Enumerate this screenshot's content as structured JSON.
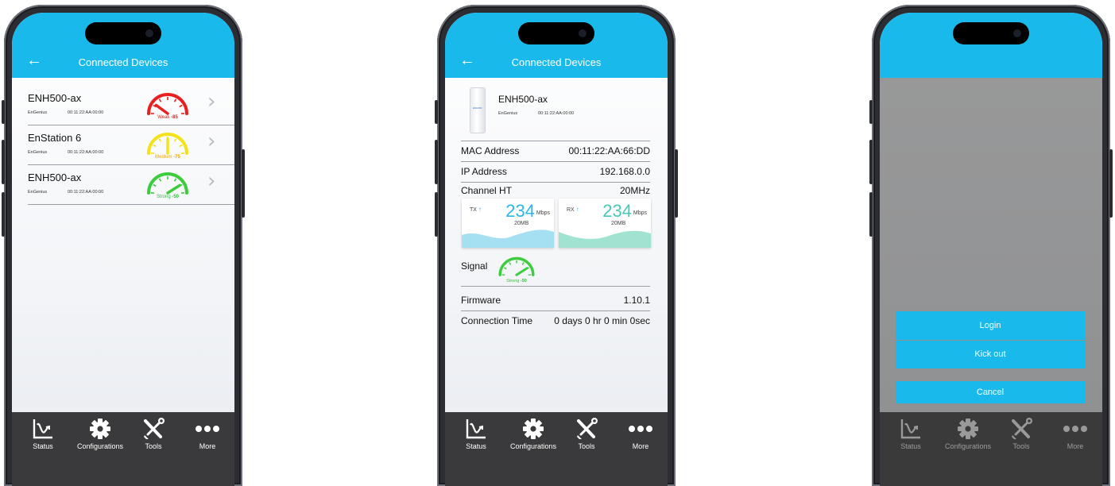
{
  "header": {
    "back_icon": "←",
    "title": "Connected Devices"
  },
  "device_list": [
    {
      "name": "ENH500-ax",
      "vendor": "EnGenius",
      "mac": "00:11:22:AA:00:00",
      "signal_label": "Weak",
      "signal_value": "-85",
      "signal_color": "#e8201f",
      "label_color": "#d8201b",
      "signal_level": 0.2
    },
    {
      "name": "EnStation 6",
      "vendor": "EnGenius",
      "mac": "00:11:22:AA:00:00",
      "signal_label": "Medium",
      "signal_value": "-75",
      "signal_color": "#f3e21a",
      "label_color": "#f0a500",
      "signal_level": 0.5
    },
    {
      "name": "ENH500-ax",
      "vendor": "EnGenius",
      "mac": "00:11:22:AA:00:00",
      "signal_label": "Strong",
      "signal_value": "-50",
      "signal_color": "#3ecc3e",
      "label_color": "#2fbf3a",
      "signal_level": 0.82
    }
  ],
  "detail": {
    "device_name": "ENH500-ax",
    "vendor": "EnGenius",
    "mac_short": "00:11:22:AA:00:00",
    "image_label": "ENH500",
    "mac_address_label": "MAC Address",
    "mac_address": "00:11:22:AA:66:DD",
    "ip_address_label": "IP Address",
    "ip_address": "192.168.0.0",
    "channel_ht_label": "Channel HT",
    "channel_ht": "20MHz",
    "tx": {
      "label": "TX",
      "arrow": "↑",
      "value": "234",
      "unit": "Mbps",
      "sub": "20MB",
      "color": "#2ab6e6",
      "wave_color": "#a5dff2"
    },
    "rx": {
      "label": "RX",
      "arrow": "↑",
      "value": "234",
      "unit": "Mbps",
      "sub": "20MB",
      "color": "#47c9b3",
      "wave_color": "#9fe3d0"
    },
    "signal_label": "Signal",
    "signal_text": "Strong",
    "signal_value": "-50",
    "signal_color": "#3ecc3e",
    "signal_level": 0.82,
    "firmware_label": "Firmware",
    "firmware": "1.10.1",
    "connection_time_label": "Connection Time",
    "connection_time": "0 days 0 hr 0 min 0sec"
  },
  "action_sheet": {
    "login": "Login",
    "kick_out": "Kick out",
    "cancel": "Cancel"
  },
  "tabs": [
    {
      "label": "Status",
      "icon": "status-chart-icon"
    },
    {
      "label": "Configurations",
      "icon": "gear-icon"
    },
    {
      "label": "Tools",
      "icon": "tools-icon"
    },
    {
      "label": "More",
      "icon": "more-dots-icon"
    }
  ],
  "colors": {
    "accent": "#19baeb",
    "tabbar": "#3a3a3c"
  }
}
